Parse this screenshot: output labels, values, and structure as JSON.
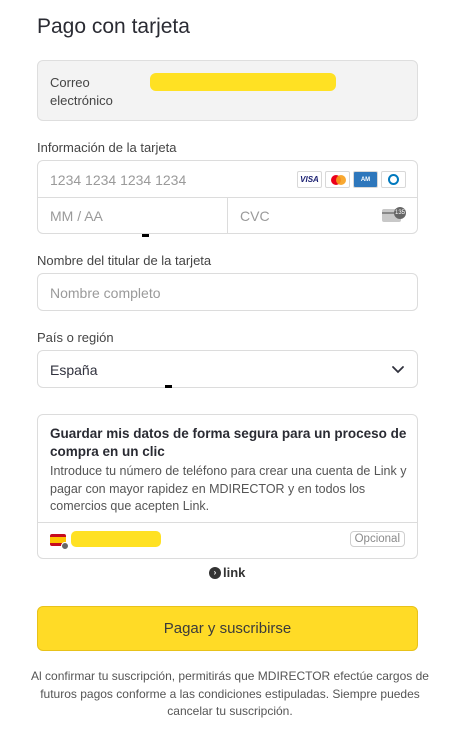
{
  "page": {
    "title": "Pago con tarjeta"
  },
  "email": {
    "label": "Correo electrónico"
  },
  "card": {
    "section_label": "Información de la tarjeta",
    "number_placeholder": "1234 1234 1234 1234",
    "expiry_placeholder": "MM / AA",
    "cvc_placeholder": "CVC",
    "brands": [
      "VISA",
      "mastercard-icon",
      "amex-icon",
      "diners-icon"
    ]
  },
  "holder": {
    "label": "Nombre del titular de la tarjeta",
    "placeholder": "Nombre completo"
  },
  "country": {
    "label": "País o región",
    "selected": "España"
  },
  "link_save": {
    "heading": "Guardar mis datos de forma segura para un proceso de compra en un clic",
    "description": "Introduce tu número de teléfono para crear una cuenta de Link y pagar con mayor rapidez en MDIRECTOR y en todos los comercios que acepten Link.",
    "optional_label": "Opcional",
    "brand": "link"
  },
  "pay_button": {
    "label": "Pagar y suscribirse"
  },
  "footer": {
    "text": "Al confirmar tu suscripción, permitirás que MDIRECTOR efectúe cargos de futuros pagos conforme a las condiciones estipuladas. Siempre puedes cancelar tu suscripción."
  },
  "colors": {
    "accent": "#ffdb26",
    "redaction": "#ffe123"
  }
}
